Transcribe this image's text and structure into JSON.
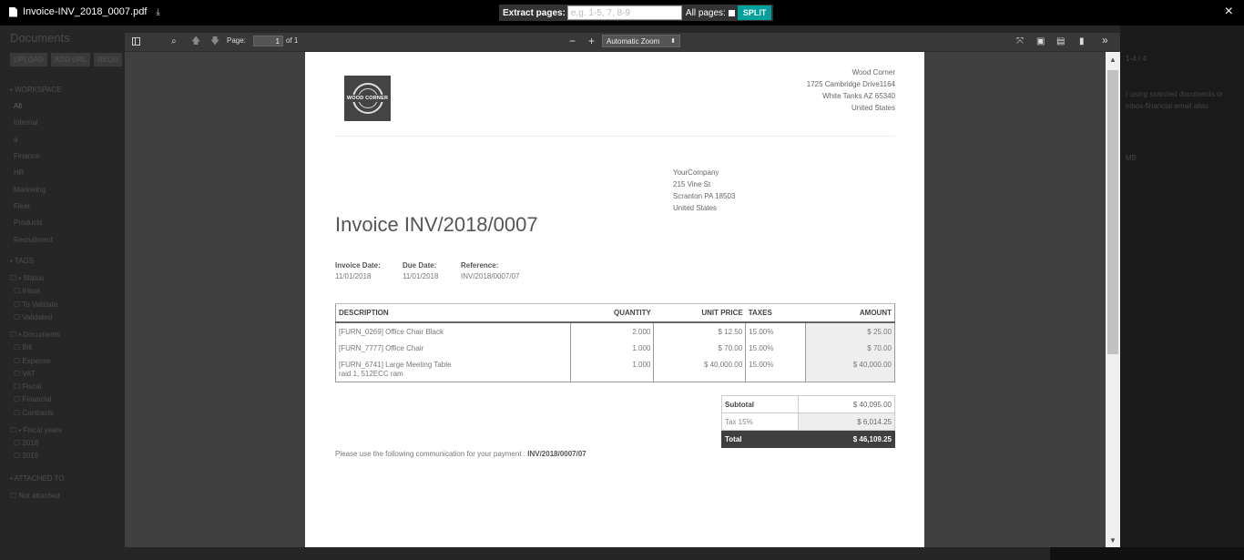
{
  "overlay": {
    "file_name": "Invoice-INV_2018_0007.pdf",
    "download_icon": "download-icon",
    "extract_label": "Extract pages:",
    "extract_placeholder": "e.g. 1-5, 7, 8-9",
    "all_pages_label": "All pages:",
    "split_label": "SPLIT",
    "close_icon": "×"
  },
  "background_app": {
    "title": "Documents",
    "buttons": [
      "UPLOAD",
      "ADD URL",
      "REQU"
    ],
    "workspace_label": "WORKSPACE",
    "workspaces": [
      "All",
      "Internal",
      "a",
      "Finance",
      "HR",
      "Marketing",
      "Fleet",
      "Products",
      "Recruitment"
    ],
    "tags_label": "TAGS",
    "tag_groups": [
      {
        "name": "Status",
        "items": [
          "Inbox",
          "To Validate",
          "Validated"
        ]
      },
      {
        "name": "Documents",
        "items": [
          "Bill",
          "Expense",
          "VAT",
          "Fiscal",
          "Financial",
          "Contracts"
        ]
      },
      {
        "name": "Fiscal years",
        "items": [
          "2018",
          "2019"
        ]
      }
    ],
    "attached_label": "ATTACHED TO",
    "attached_items": [
      "Not attached"
    ],
    "right_pager": "1-4 / 4",
    "right_text_1": "r using scanned documents or",
    "right_text_2": "inbox-financial email alias",
    "right_text_3": "MB"
  },
  "viewer": {
    "page_label": "Page:",
    "page_value": "1",
    "page_of": "of 1",
    "zoom_out": "−",
    "zoom_in": "+",
    "zoom_value": "Automatic Zoom"
  },
  "invoice": {
    "vendor": [
      "Wood Corner",
      "1725 Cambridge Drive1164",
      "White Tanks AZ 65340",
      "United States"
    ],
    "logo_text": "WOOD CORNER",
    "partner": [
      "YourCompany",
      "215 Vine St",
      "Scranton PA 18503",
      "United States"
    ],
    "title": "Invoice INV/2018/0007",
    "invoice_date_label": "Invoice Date:",
    "invoice_date": "11/01/2018",
    "due_date_label": "Due Date:",
    "due_date": "11/01/2018",
    "reference_label": "Reference:",
    "reference": "INV/2018/0007/07",
    "columns": [
      "DESCRIPTION",
      "QUANTITY",
      "UNIT PRICE",
      "TAXES",
      "AMOUNT"
    ],
    "lines": [
      {
        "description": "[FURN_0269] Office Chair Black",
        "extra": "",
        "quantity": "2.000",
        "unit_price": "$ 12.50",
        "taxes": "15.00%",
        "amount": "$ 25.00"
      },
      {
        "description": "[FURN_7777] Office Chair",
        "extra": "",
        "quantity": "1.000",
        "unit_price": "$ 70.00",
        "taxes": "15.00%",
        "amount": "$ 70.00"
      },
      {
        "description": "[FURN_6741] Large Meeting Table",
        "extra": "raid 1, 512ECC ram",
        "quantity": "1.000",
        "unit_price": "$ 40,000.00",
        "taxes": "15.00%",
        "amount": "$ 40,000.00"
      }
    ],
    "subtotal_label": "Subtotal",
    "subtotal": "$ 40,095.00",
    "tax_label": "Tax 15%",
    "tax": "$ 6,014.25",
    "total_label": "Total",
    "total": "$ 46,109.25",
    "communication_label": "Please use the following communication for your payment :",
    "communication": "INV/2018/0007/07"
  }
}
